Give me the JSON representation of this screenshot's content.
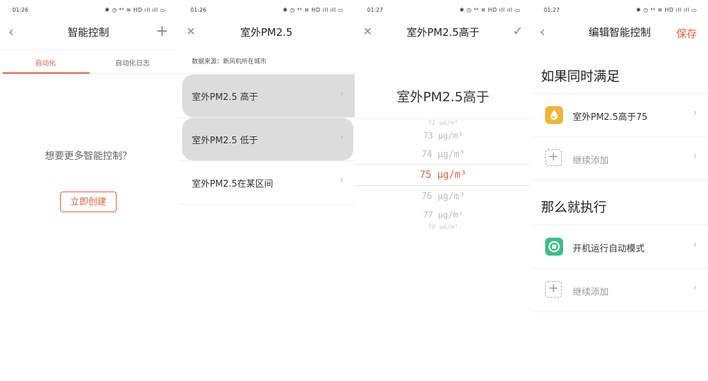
{
  "status": {
    "p1_time": "01:26",
    "p2_time": "01:26",
    "p3_time": "01:27",
    "p4_time": "01:27",
    "icons": "✱ ◷ ⁴⁶ ≋ HD ıll ıll ▭"
  },
  "p1": {
    "back_icon": "‹",
    "title": "智能控制",
    "add_icon": "+",
    "tabs": [
      "自动化",
      "自动化日志"
    ],
    "empty_text": "想要更多智能控制？",
    "create_label": "立即创建"
  },
  "p2": {
    "close_icon": "✕",
    "title": "室外PM2.5",
    "source": "数据来源：新风机所在城市",
    "options": [
      "室外PM2.5 高于",
      "室外PM2.5 低于",
      "室外PM2.5在某区间"
    ],
    "chevron": "›"
  },
  "p3": {
    "close_icon": "✕",
    "title": "室外PM2.5高于",
    "confirm_icon": "✓",
    "picker_title": "室外PM2.5高于",
    "values": [
      "72 μg/m³",
      "73 μg/m³",
      "74 μg/m³",
      "75 μg/m³",
      "76 μg/m³",
      "77 μg/m³",
      "78 μg/m³"
    ],
    "selected": 75
  },
  "p4": {
    "back_icon": "‹",
    "title": "编辑智能控制",
    "save_label": "保存",
    "if_heading": "如果同时满足",
    "condition_label": "室外PM2.5高于75",
    "add_more_1": "继续添加",
    "then_heading": "那么就执行",
    "action_label": "开机运行自动模式",
    "add_more_2": "继续添加",
    "chevron": "›",
    "condition_icon_color": "#f0b43a",
    "action_icon_color": "#3fbf87"
  }
}
